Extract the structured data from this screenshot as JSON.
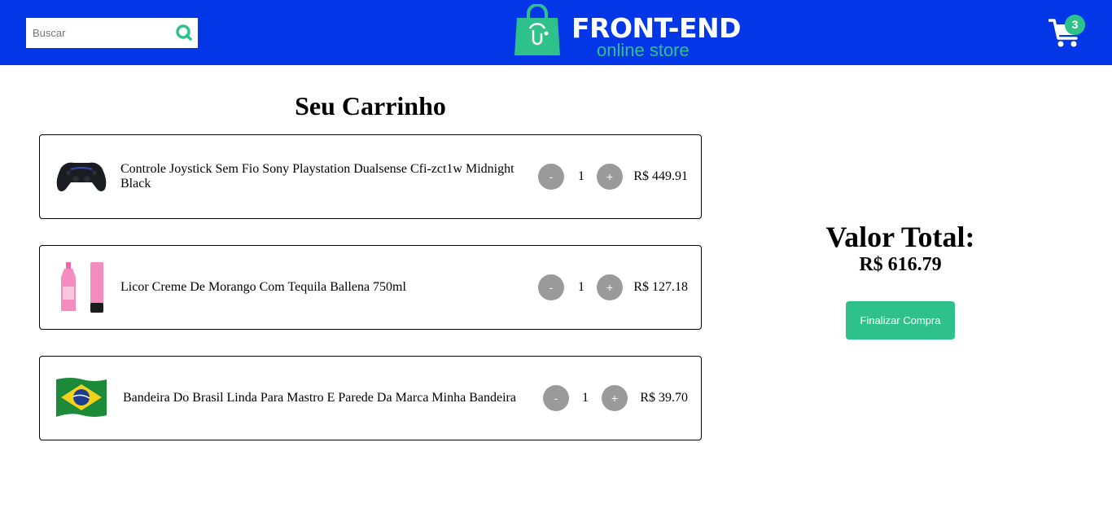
{
  "header": {
    "search": {
      "placeholder": "Buscar",
      "value": ""
    },
    "logo": {
      "title": "FRONT-END",
      "subtitle": "online store"
    },
    "cart": {
      "count": "3"
    }
  },
  "cart": {
    "title": "Seu Carrinho",
    "items": [
      {
        "name": "Controle Joystick Sem Fio Sony Playstation Dualsense Cfi-zct1w Midnight Black",
        "quantity": "1",
        "price": "R$ 449.91",
        "decrease_label": "-",
        "increase_label": "+"
      },
      {
        "name": "Licor Creme De Morango Com Tequila Ballena 750ml",
        "quantity": "1",
        "price": "R$ 127.18",
        "decrease_label": "-",
        "increase_label": "+"
      },
      {
        "name": "Bandeira Do Brasil Linda Para Mastro E Parede Da Marca Minha Bandeira",
        "quantity": "1",
        "price": "R$ 39.70",
        "decrease_label": "-",
        "increase_label": "+"
      }
    ]
  },
  "summary": {
    "total_label": "Valor Total:",
    "total_value": "R$ 616.79",
    "checkout_label": "Finalizar Compra"
  },
  "colors": {
    "header": "#0336e6",
    "accent": "#2fc18c",
    "qty_button": "#9a9a9a"
  }
}
